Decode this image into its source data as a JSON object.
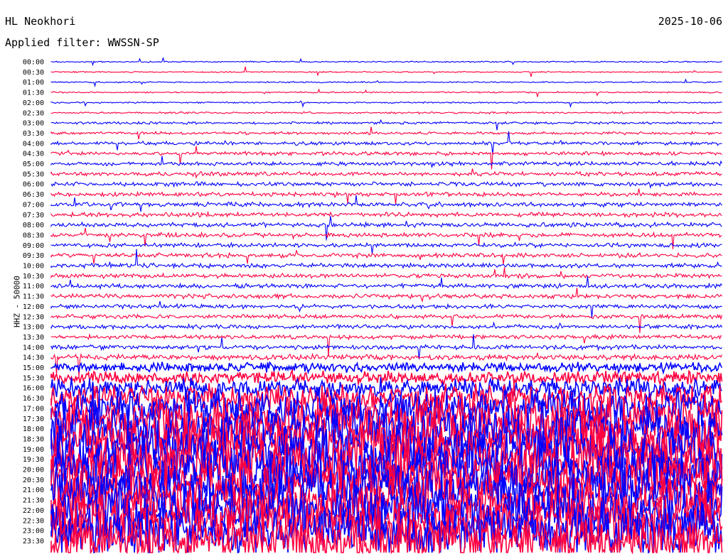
{
  "header": {
    "station": "HL Neokhori",
    "date": "2025-10-06",
    "filter_label": "Applied filter: WWSSN-SP"
  },
  "chart_data": {
    "type": "line",
    "title": "HL Neokhori",
    "subtitle": "Applied filter: WWSSN-SP",
    "ylabel": "HHZ - 50000",
    "categories": [
      "00:00",
      "00:30",
      "01:00",
      "01:30",
      "02:00",
      "02:30",
      "03:00",
      "03:30",
      "04:00",
      "04:30",
      "05:00",
      "05:30",
      "06:00",
      "06:30",
      "07:00",
      "07:30",
      "08:00",
      "08:30",
      "09:00",
      "09:30",
      "10:00",
      "10:30",
      "11:00",
      "11:30",
      "12:00",
      "12:30",
      "13:00",
      "13:30",
      "14:00",
      "14:30",
      "15:00",
      "15:30",
      "16:00",
      "16:30",
      "17:00",
      "17:30",
      "18:00",
      "18:30",
      "19:00",
      "19:30",
      "20:00",
      "20:30",
      "21:00",
      "21:30",
      "22:00",
      "22:30",
      "23:00",
      "23:30"
    ],
    "series_colors": [
      "#0000ff",
      "#ff0040"
    ],
    "noise_level": [
      0.8,
      0.8,
      0.9,
      0.9,
      0.9,
      1.2,
      1.5,
      1.8,
      2.2,
      2.4,
      2.5,
      2.6,
      2.6,
      2.6,
      2.8,
      2.8,
      2.8,
      2.8,
      2.8,
      2.8,
      2.8,
      2.8,
      2.8,
      2.8,
      2.6,
      2.6,
      2.6,
      2.6,
      3,
      3.5,
      6,
      8,
      12,
      18,
      25,
      30,
      32,
      34,
      34,
      34,
      34,
      34,
      34,
      34,
      34,
      34,
      34,
      34
    ],
    "grid": false
  }
}
